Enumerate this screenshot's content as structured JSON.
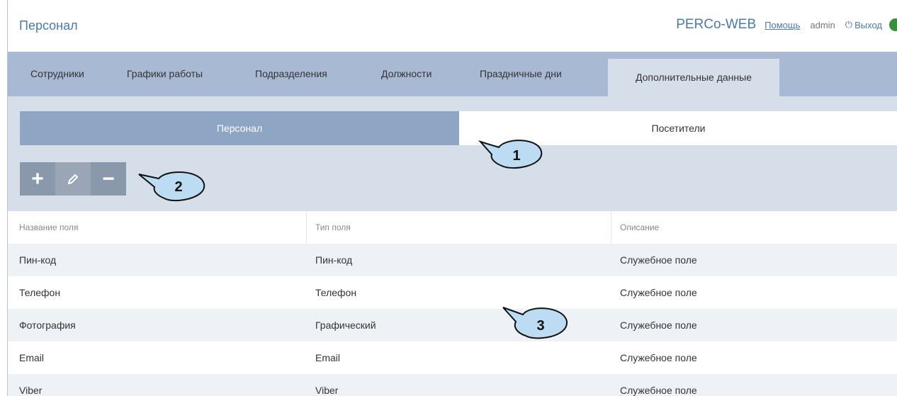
{
  "header": {
    "page_title": "Персонал",
    "brand": "PERCo-WEB",
    "help": "Помощь",
    "user": "admin",
    "logout": "Выход"
  },
  "nav": {
    "tabs": [
      {
        "label": "Сотрудники"
      },
      {
        "label": "Графики работы"
      },
      {
        "label": "Подразделения"
      },
      {
        "label": "Должности"
      },
      {
        "label": "Праздничные дни"
      },
      {
        "label": "Дополнительные данные",
        "active": true
      }
    ]
  },
  "subtabs": [
    {
      "label": "Персонал",
      "active": true
    },
    {
      "label": "Посетители"
    }
  ],
  "toolbar": {
    "add": "+",
    "edit": "✎",
    "remove": "−"
  },
  "table": {
    "columns": [
      "Название поля",
      "Тип поля",
      "Описание"
    ],
    "rows": [
      [
        "Пин-код",
        "Пин-код",
        "Служебное поле"
      ],
      [
        "Телефон",
        "Телефон",
        "Служебное поле"
      ],
      [
        "Фотография",
        "Графический",
        "Служебное поле"
      ],
      [
        "Email",
        "Email",
        "Служебное поле"
      ],
      [
        "Viber",
        "Viber",
        "Служебное поле"
      ]
    ]
  },
  "callouts": [
    "1",
    "2",
    "3"
  ],
  "colors": {
    "accent": "#4a78b4",
    "nav_bg": "#a7b9d3",
    "content_bg": "#d6dee9",
    "status_online": "#3a8e3d"
  }
}
